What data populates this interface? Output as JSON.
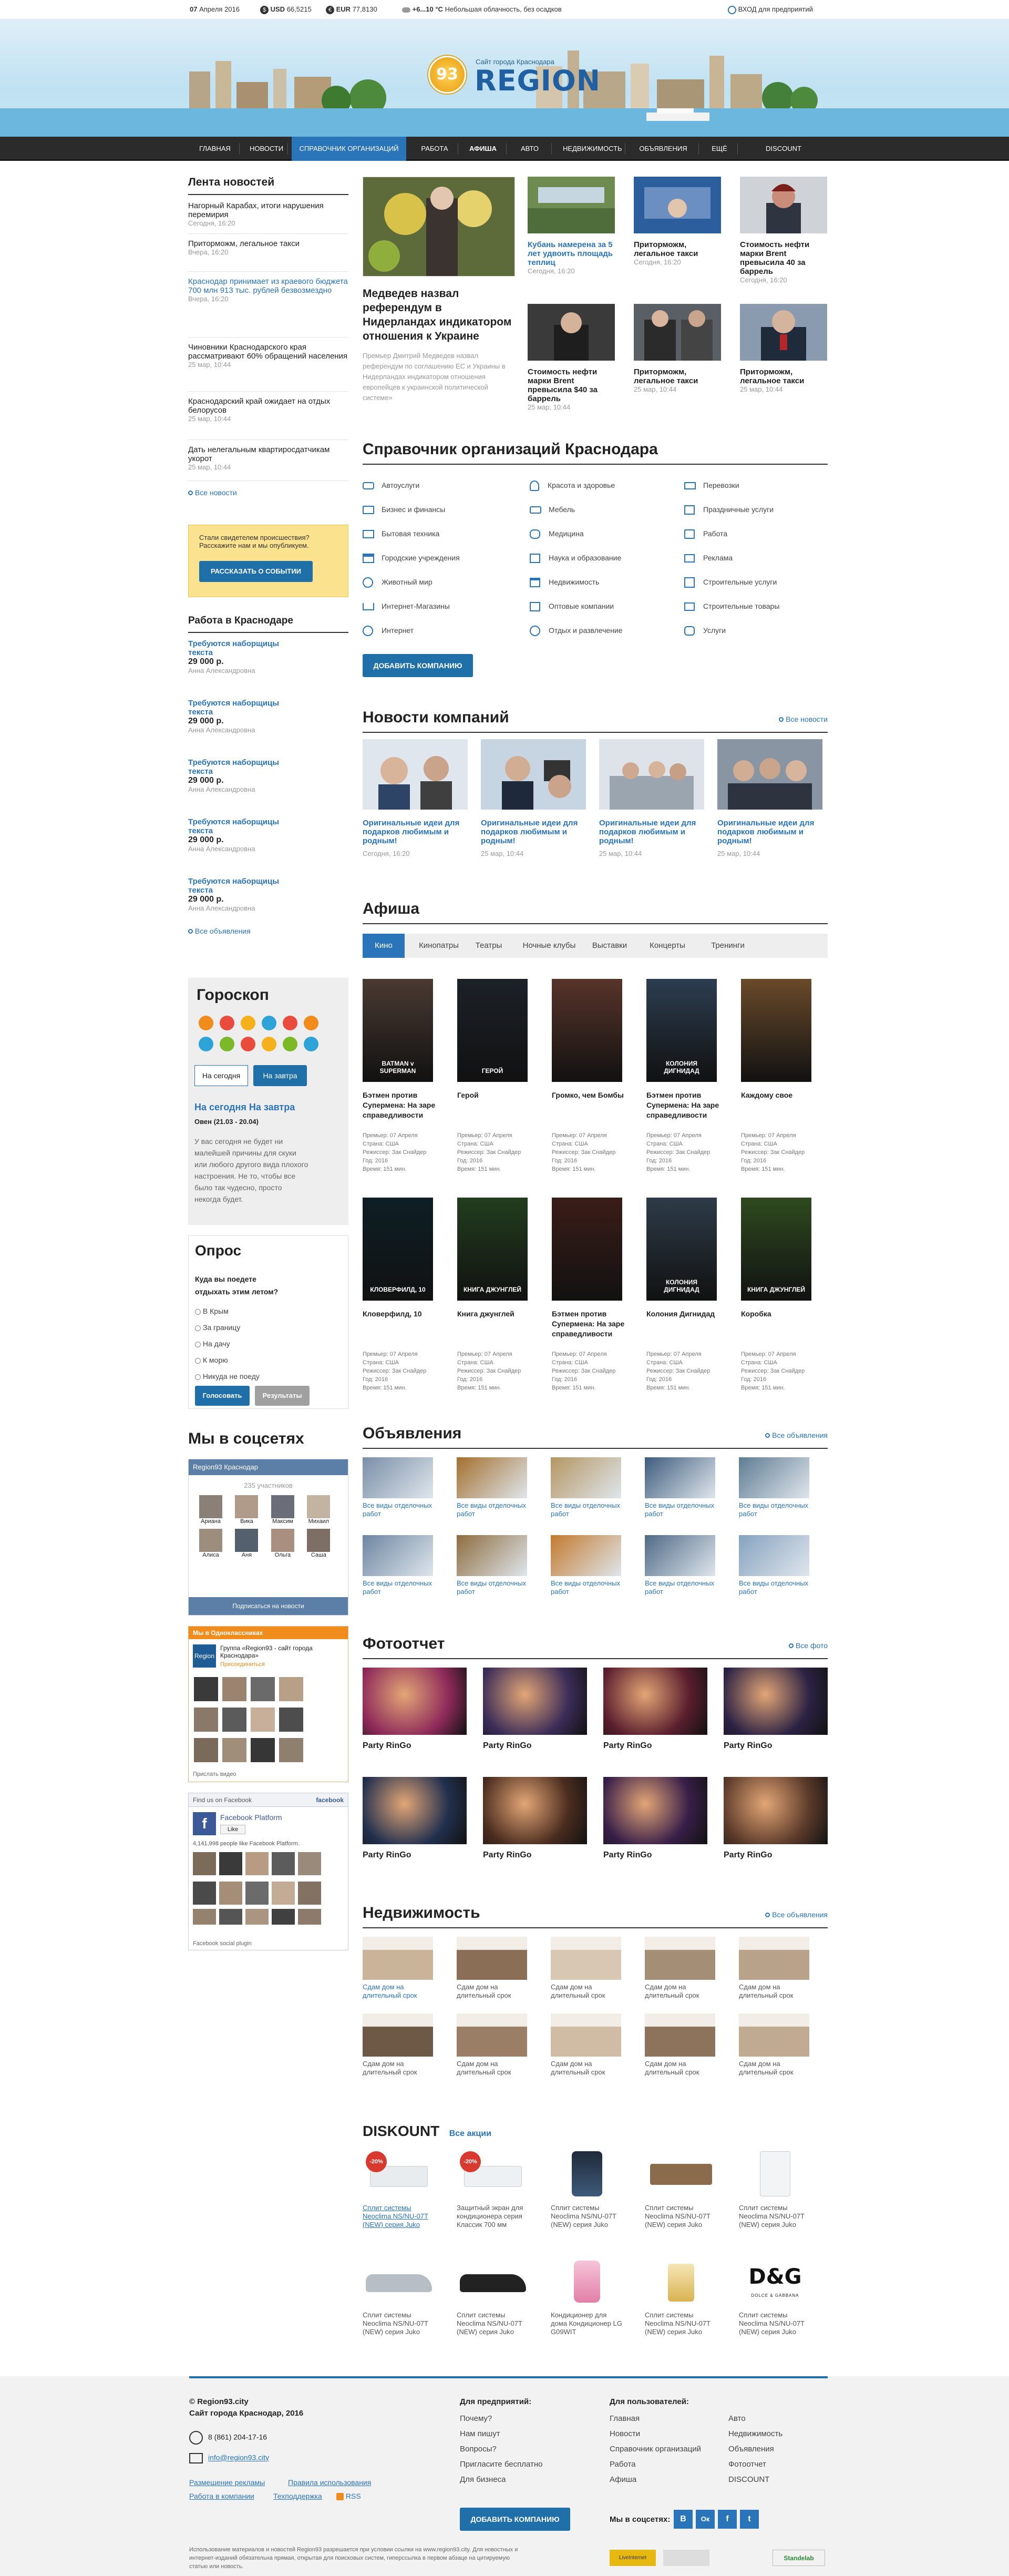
{
  "topbar": {
    "day": "07",
    "month_year": "Апреля 2016",
    "usd_label": "USD",
    "usd_value": "66,5215",
    "eur_label": "EUR",
    "eur_value": "77,8130",
    "temp": "+6...10 °С",
    "weather": "Небольшая облачность, без осадков",
    "login": "ВХОД для предприятий"
  },
  "logo": {
    "badge": "93",
    "small": "Сайт города Краснодара",
    "title": "REGION"
  },
  "nav": [
    "ГЛАВНАЯ",
    "НОВОСТИ",
    "СПРАВОЧНИК ОРГАНИЗАЦИЙ",
    "РАБОТА",
    "АФИША",
    "АВТО",
    "НЕДВИЖИМОСТЬ",
    "ОБЪЯВЛЕНИЯ",
    "ЕЩЁ",
    "DISCOUNT"
  ],
  "news_feed": {
    "title": "Лента новостей",
    "items": [
      {
        "text": "Нагорный Карабах, итоги нарушения перемирия",
        "date": "Сегодня, 16:20",
        "link": false
      },
      {
        "text": "Приторможм, легальное такси",
        "date": "Вчера, 16:20",
        "link": false
      },
      {
        "text": "Краснодар принимает из краевого бюджета 700 млн 913 тыс. рублей безвозмездно",
        "date": "Вчера, 16:20",
        "link": true
      },
      {
        "text": "Чиновники Краснодарского края рассматривают 60% обращений населения",
        "date": "25 мар, 10:44",
        "link": false
      },
      {
        "text": "Краснодарский край ожидает на отдых белорусов",
        "date": "25 мар, 10:44",
        "link": false
      },
      {
        "text": "Дать нелегальным квартиросдатчикам укорот",
        "date": "25 мар, 10:44",
        "link": false
      }
    ],
    "all": "Все новости"
  },
  "witness": {
    "text": "Стали свидетелем происшествия? Расскажите нам и мы опубликуем.",
    "button": "РАССКАЗАТЬ О СОБЫТИИ"
  },
  "jobs": {
    "title": "Работа в Краснодаре",
    "items": [
      {
        "title": "Требуются наборщицы текста",
        "price": "29 000 р.",
        "name": "Анна Александровна"
      },
      {
        "title": "Требуются наборщицы текста",
        "price": "29 000 р.",
        "name": "Анна Александровна"
      },
      {
        "title": "Требуются наборщицы текста",
        "price": "29 000 р.",
        "name": "Анна Александровна"
      },
      {
        "title": "Требуются наборщицы текста",
        "price": "29 000 р.",
        "name": "Анна Александровна"
      },
      {
        "title": "Требуются наборщицы текста",
        "price": "29 000 р.",
        "name": "Анна Александровна"
      }
    ],
    "all": "Все объявления"
  },
  "horoscope": {
    "title": "Гороскоп",
    "tab_today": "На сегодня",
    "tab_tomorrow": "На завтра",
    "sign": "На сегодня На завтра",
    "period": "Овен (21.03 - 20.04)",
    "text": "У вас сегодня не будет ни малейшей причины для скуки или любого другого вида плохого настроения. Не то, чтобы все было так чудесно, просто некогда будет."
  },
  "poll": {
    "title": "Опрос",
    "question": "Куда вы поедете отдыхать этим летом?",
    "options": [
      "В Крым",
      "За границу",
      "На дачу",
      "К морю",
      "Никуда не поеду"
    ],
    "vote": "Голосовать",
    "results": "Результаты"
  },
  "social": {
    "title": "Мы в соцсетях",
    "vk_group": "Region93 Краснодар",
    "vk_count": "235 участников",
    "vk_names": [
      "Ариана",
      "Вика",
      "Максим",
      "Михаил",
      "Алиса",
      "Аня",
      "Ольга",
      "Саша"
    ],
    "vk_subscribe": "Подписаться на новости",
    "ok_header": "Мы в Одноклассниках",
    "ok_group": "Группа «Region93 - сайт города Краснодара»",
    "ok_join": "Присоединиться",
    "ok_footer": "Прислать видео",
    "fb_header": "Find us on Facebook",
    "fb_brand": "facebook",
    "fb_page": "Facebook Platform",
    "fb_like": "Like",
    "fb_count": "4,141,998 people like Facebook Platform.",
    "fb_plugin": "Facebook social plugin"
  },
  "main_news": {
    "title": "Медведев назвал референдум в Нидерландах индикатором отношения к Украине",
    "lead": "Премьер Дмитрий Медведев назвал референдум по соглашению ЕС и Украины в Нидерландах индикатором отношения европейцев к украинской политической системе»",
    "small": [
      {
        "title": "Кубань намерена за 5 лет удвоить площадь теплиц",
        "date": "Сегодня, 16:20",
        "blue": true
      },
      {
        "title": "Приторможм, легальное такси",
        "date": "Сегодня, 16:20",
        "blue": false
      },
      {
        "title": "Стоимость нефти марки Brent превысила 40 за баррель",
        "date": "Сегодня, 16:20",
        "blue": false
      },
      {
        "title": "Стоимость нефти марки Brent превысила $40 за баррель",
        "date": "25 мар, 10:44",
        "blue": false
      },
      {
        "title": "Приторможм, легальное такси",
        "date": "25 мар, 10:44",
        "blue": false
      },
      {
        "title": "Приторможм, легальное такси",
        "date": "25 мар, 10:44",
        "blue": false
      }
    ]
  },
  "directory": {
    "title": "Справочник организаций Краснодара",
    "cols": [
      [
        "Автоуслуги",
        "Бизнес и финансы",
        "Бытовая техника",
        "Городские учреждения",
        "Животный мир",
        "Интернет-Магазины",
        "Интернет"
      ],
      [
        "Красота и здоровье",
        "Мебель",
        "Медицина",
        "Наука и образование",
        "Недвижимость",
        "Оптовые компании",
        "Отдых и развлечение"
      ],
      [
        "Перевозки",
        "Праздничные услуги",
        "Работа",
        "Реклама",
        "Строительные услуги",
        "Строительные товары",
        "Услуги"
      ]
    ],
    "button": "ДОБАВИТЬ КОМПАНИЮ"
  },
  "company_news": {
    "title": "Новости компаний",
    "all": "Все новости",
    "items": [
      {
        "title": "Оригинальные идеи для подарков любимым и родным!",
        "date": "Сегодня, 16:20"
      },
      {
        "title": "Оригинальные идеи для подарков любимым и родным!",
        "date": "25 мар, 10:44"
      },
      {
        "title": "Оригинальные идеи для подарков любимым и родным!",
        "date": "25 мар, 10:44"
      },
      {
        "title": "Оригинальные идеи для подарков любимым и родным!",
        "date": "25 мар, 10:44"
      }
    ]
  },
  "afisha": {
    "title": "Афиша",
    "tabs": [
      "Кино",
      "Кинопатры",
      "Театры",
      "Ночные клубы",
      "Выставки",
      "Концерты",
      "Тренинги"
    ],
    "movies": [
      {
        "title": "Бэтмен против Супермена: На заре справедливости",
        "p1": "Премьер: 07 Апреля",
        "p2": "Страна: США",
        "p3": "Режиссер: Зак Снайдер",
        "p4": "Год: 2016",
        "p5": "Время: 151 мин.",
        "poster": "BATMAN v SUPERMAN"
      },
      {
        "title": "Герой",
        "p1": "Премьер: 07 Апреля",
        "p2": "Страна: США",
        "p3": "Режиссер: Зак Снайдер",
        "p4": "Год: 2016",
        "p5": "Время: 151 мин.",
        "poster": "ГЕРОЙ"
      },
      {
        "title": "Громко, чем Бомбы",
        "p1": "Премьер: 07 Апреля",
        "p2": "Страна: США",
        "p3": "Режиссер: Зак Снайдер",
        "p4": "Год: 2016",
        "p5": "Время: 151 мин.",
        "poster": ""
      },
      {
        "title": "Бэтмен против Супермена: На заре справедливости",
        "p1": "Премьер: 07 Апреля",
        "p2": "Страна: США",
        "p3": "Режиссер: Зак Снайдер",
        "p4": "Год: 2016",
        "p5": "Время: 151 мин.",
        "poster": "КОЛОНИЯ ДИГНИДАД"
      },
      {
        "title": "Каждому свое",
        "p1": "Премьер: 07 Апреля",
        "p2": "Страна: США",
        "p3": "Режиссер: Зак Снайдер",
        "p4": "Год: 2016",
        "p5": "Время: 151 мин.",
        "poster": ""
      },
      {
        "title": "Кловерфилд, 10",
        "p1": "Премьер: 07 Апреля",
        "p2": "Страна: США",
        "p3": "Режиссер: Зак Снайдер",
        "p4": "Год: 2016",
        "p5": "Время: 151 мин.",
        "poster": "КЛОВЕРФИЛД, 10"
      },
      {
        "title": "Книга джунглей",
        "p1": "Премьер: 07 Апреля",
        "p2": "Страна: США",
        "p3": "Режиссер: Зак Снайдер",
        "p4": "Год: 2016",
        "p5": "Время: 151 мин.",
        "poster": "КНИГА ДЖУНГЛЕЙ"
      },
      {
        "title": "Бэтмен против Супермена: На заре справедливости",
        "p1": "Премьер: 07 Апреля",
        "p2": "Страна: США",
        "p3": "Режиссер: Зак Снайдер",
        "p4": "Год: 2016",
        "p5": "Время: 151 мин.",
        "poster": ""
      },
      {
        "title": "Колония Дигнидад",
        "p1": "Премьер: 07 Апреля",
        "p2": "Страна: США",
        "p3": "Режиссер: Зак Снайдер",
        "p4": "Год: 2016",
        "p5": "Время: 151 мин.",
        "poster": "КОЛОНИЯ ДИГНИДАД"
      },
      {
        "title": "Коробка",
        "p1": "Премьер: 07 Апреля",
        "p2": "Страна: США",
        "p3": "Режиссер: Зак Снайдер",
        "p4": "Год: 2016",
        "p5": "Время: 151 мин.",
        "poster": "КНИГА ДЖУНГЛЕЙ"
      }
    ]
  },
  "ads": {
    "title": "Объявления",
    "all": "Все объявления",
    "item": "Все виды отделочных работ"
  },
  "photo": {
    "title": "Фотоотчет",
    "all": "Все фото",
    "item": "Party RinGo"
  },
  "realty": {
    "title": "Недвижимость",
    "all": "Все объявления",
    "item": "Сдам дом на длительный срок"
  },
  "discount": {
    "title": "DISKOUNT",
    "all": "Все акции",
    "badge": "-20%",
    "items": [
      "Сплит системы Neoclima NS/NU-07T (NEW) серия Juko",
      "Защитный экран для кондиционера серия Классик 700 мм",
      "Сплит системы Neoclima NS/NU-07T (NEW) серия Juko",
      "Сплит системы Neoclima NS/NU-07T (NEW) серия Juko",
      "Сплит системы Neoclima NS/NU-07T (NEW) серия Juko",
      "Сплит системы Neoclima NS/NU-07T (NEW) серия Juko",
      "Сплит системы Neoclima NS/NU-07T (NEW) серия Juko",
      "Кондиционер для дома Кондиционер LG G09WIT",
      "Сплит системы Neoclima NS/NU-07T (NEW) серия Juko",
      "Сплит системы Neoclima NS/NU-07T (NEW) серия Juko"
    ],
    "brand": "D&G",
    "brand_sub": "DOLCE & GABBANA"
  },
  "footer": {
    "copyright": "© Region93.city",
    "subtitle": "Сайт города Краснодар, 2016",
    "phone": "8 (861) 204-17-16",
    "email": "info@region93.city",
    "link1": "Размещение рекламы",
    "link2": "Правила использования",
    "link3": "Работа в компании",
    "link4": "Техподдержка",
    "rss": "RSS",
    "col1_title": "Для предприятий:",
    "col1": [
      "Почему?",
      "Нам пишут",
      "Вопросы?",
      "Пригласите бесплатно",
      "Для бизнеса"
    ],
    "col2_title": "Для пользователей:",
    "col2a": [
      "Главная",
      "Новости",
      "Справочник организаций",
      "Работа",
      "Афиша"
    ],
    "col2b": [
      "Авто",
      "Недвижимость",
      "Объявления",
      "Фотоотчет",
      "DISCOUNT"
    ],
    "add_button": "ДОБАВИТЬ КОМПАНИЮ",
    "social_label": "Мы в соцсетях:",
    "social": [
      "В",
      "Ок",
      "f",
      "t"
    ],
    "legal": "Использование материалов и новостей Region93 разрешается при условии ссылки на www.region93.city. Для новостных и интернет-изданий обязательна прямая, открытая для поисковых систем, гиперссылка в первом абзаце на цитируемую статью или новость.",
    "counter": "LiveInternet",
    "partner": "Standelab"
  }
}
